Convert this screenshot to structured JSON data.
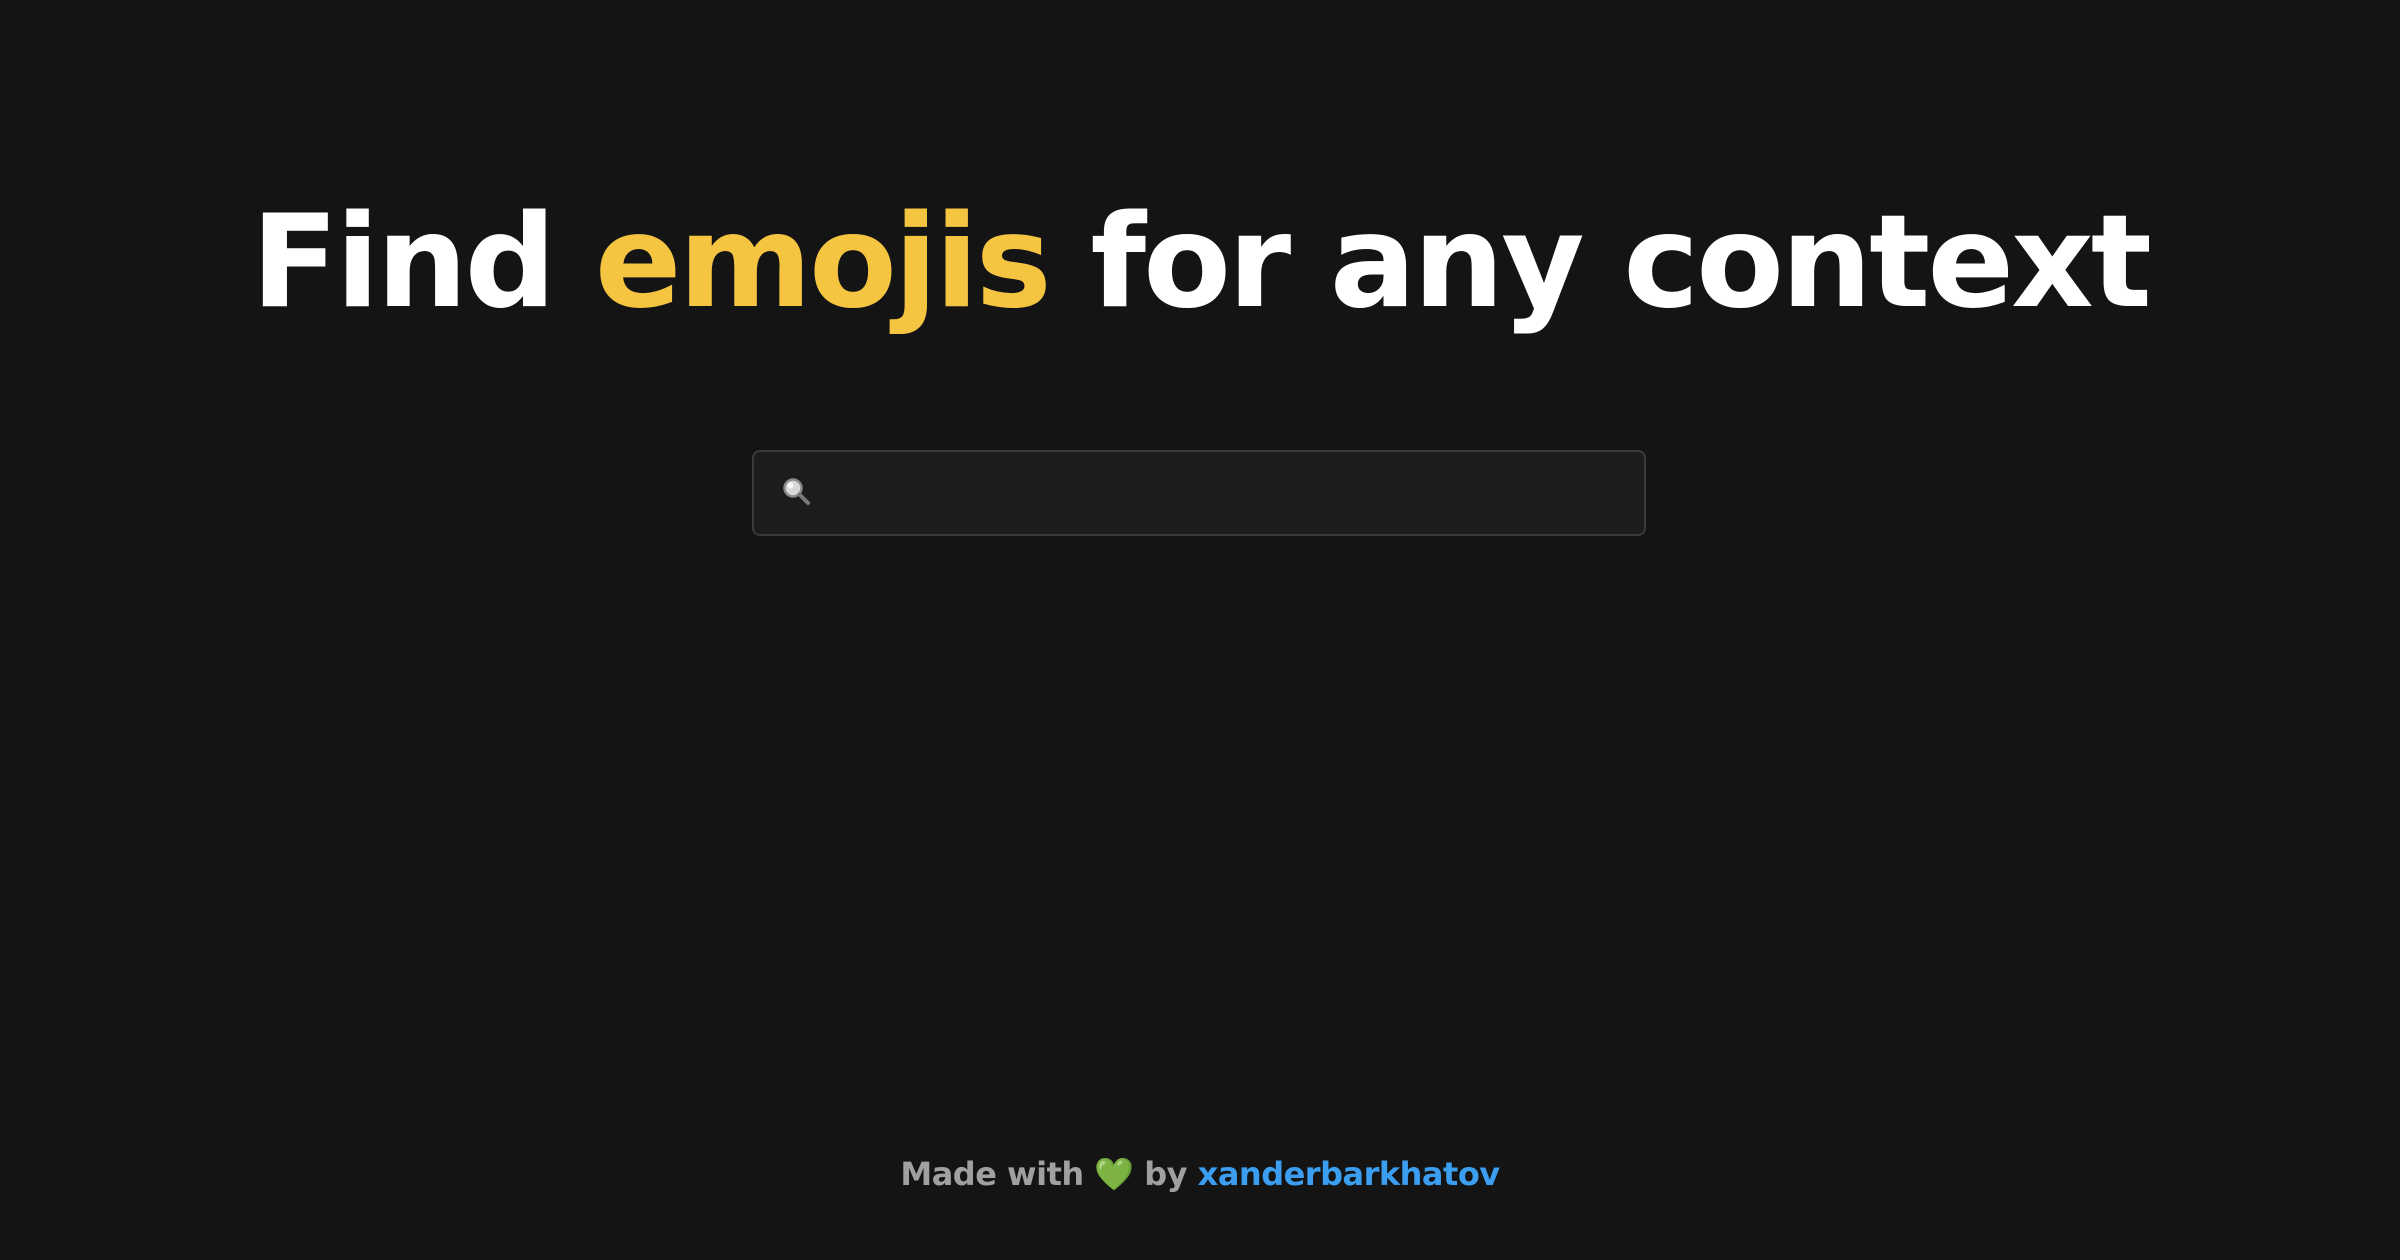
{
  "heading": {
    "part1": "Find ",
    "accent": "emojis",
    "part2": " for any context"
  },
  "search": {
    "icon": "magnifying-glass-icon",
    "value": "",
    "placeholder": ""
  },
  "footer": {
    "made_with": "Made with ",
    "heart": "💚",
    "by": " by ",
    "author": "xanderbarkhatov"
  },
  "colors": {
    "background": "#141414",
    "accent": "#f5c542",
    "link": "#3b9ef0",
    "heart": "#4cd964"
  }
}
